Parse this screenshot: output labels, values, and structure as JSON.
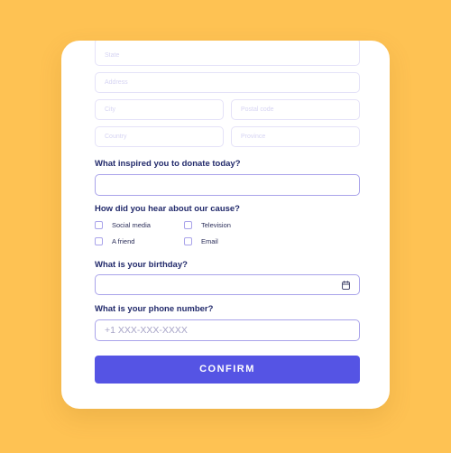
{
  "address_fields": {
    "state_placeholder": "State",
    "address_placeholder": "Address",
    "city_placeholder": "City",
    "postal_code_placeholder": "Postal code",
    "country_placeholder": "Country",
    "province_placeholder": "Province"
  },
  "inspiration": {
    "question": "What inspired you to donate today?",
    "value": ""
  },
  "referral": {
    "question": "How did you hear about our cause?",
    "options": [
      {
        "label": "Social media",
        "checked": false
      },
      {
        "label": "Television",
        "checked": false
      },
      {
        "label": "A friend",
        "checked": false
      },
      {
        "label": "Email",
        "checked": false
      }
    ]
  },
  "birthday": {
    "question": "What is your birthday?",
    "value": "",
    "icon": "calendar-icon"
  },
  "phone": {
    "question": "What is your phone number?",
    "placeholder": "+1 XXX-XXX-XXXX"
  },
  "confirm_label": "CONFIRM",
  "colors": {
    "background": "#FEC253",
    "accent": "#5554E4",
    "heading": "#222A6B",
    "input_border": "#A9A3EA"
  }
}
